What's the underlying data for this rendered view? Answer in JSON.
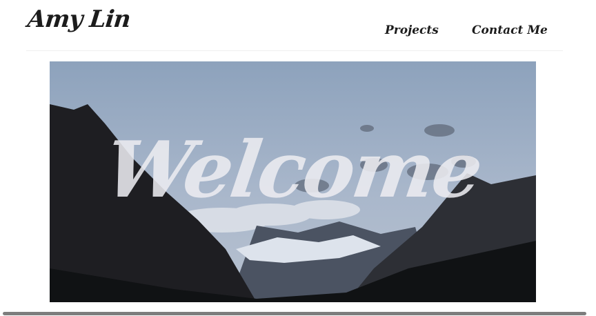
{
  "site": {
    "logo": "Amy Lin"
  },
  "nav": {
    "items": [
      {
        "label": "Projects"
      },
      {
        "label": "Contact Me"
      }
    ]
  },
  "hero": {
    "title": "Welcome"
  },
  "colors": {
    "text": "#1c1c1c",
    "divider": "#efefef",
    "sky": "#8ea3bd",
    "scrollbar": "#7d7d7d"
  }
}
